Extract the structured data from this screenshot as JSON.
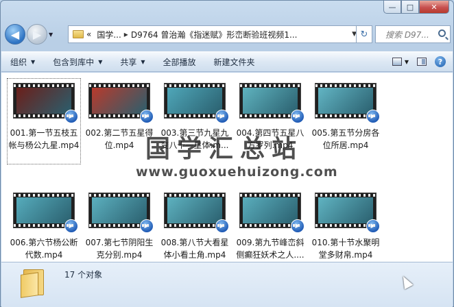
{
  "window": {
    "minimize": "—",
    "maximize": "□",
    "close": "✕"
  },
  "address": {
    "crumb_root": "«",
    "crumb1": "国学...",
    "crumb2": "D9764 曾治瀚《指迷赋》形峦断验班视频1..."
  },
  "search": {
    "placeholder": "搜索 D97..."
  },
  "toolbar": {
    "organize": "组织",
    "include": "包含到库中",
    "share": "共享",
    "play_all": "全部播放",
    "new_folder": "新建文件夹"
  },
  "files": [
    {
      "name": "001.第一节五枝五帐与杨公九星.mp4",
      "selected": true,
      "scene": "#6b1f1a"
    },
    {
      "name": "002.第二节五星得位.mp4",
      "selected": false,
      "scene": "#b83a2c"
    },
    {
      "name": "003.第三节九星九变八十一星体.m...",
      "selected": false,
      "scene": "#4fa7b9"
    },
    {
      "name": "004.第四节五星八方罗列.mp4",
      "selected": false,
      "scene": "#5fb3bf"
    },
    {
      "name": "005.第五节分房各位所居.mp4",
      "selected": false,
      "scene": "#62b5c4"
    },
    {
      "name": "006.第六节杨公断代数.mp4",
      "selected": false,
      "scene": "#56acbc"
    },
    {
      "name": "007.第七节阴阳生克分别.mp4",
      "selected": false,
      "scene": "#5cb0bf"
    },
    {
      "name": "008.第八节大看星体小看土角.mp4",
      "selected": false,
      "scene": "#5eb2c0"
    },
    {
      "name": "009.第九节峰峦斜侧癫狂妖术之人....",
      "selected": false,
      "scene": "#5aaebd"
    },
    {
      "name": "010.第十节水聚明堂多财帛.mp4",
      "selected": false,
      "scene": "#60b4c2"
    }
  ],
  "watermark": {
    "title": "国学汇总站",
    "url": "www.guoxuehuizong.com"
  },
  "status": {
    "count": "17 个对象"
  }
}
